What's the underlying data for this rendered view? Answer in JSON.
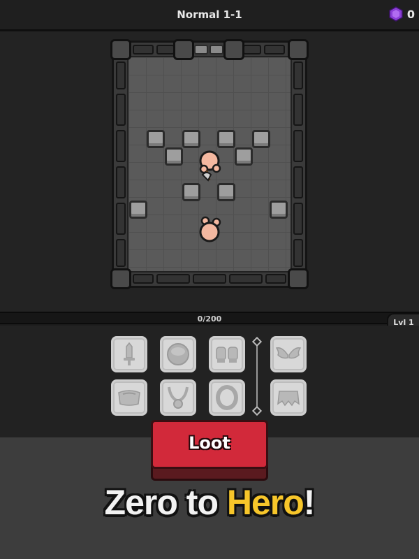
{
  "header": {
    "level_title": "Normal 1-1",
    "gem_count": "0",
    "gem_icon": "purple-gem-icon",
    "gem_color": "#8a3dd6"
  },
  "progress": {
    "xp_text": "0/200",
    "level_badge": "Lvl 1"
  },
  "equipment": {
    "slots": [
      {
        "name": "sword-icon"
      },
      {
        "name": "shield-icon"
      },
      {
        "name": "gloves-icon"
      },
      {
        "name": "wings-icon"
      },
      {
        "name": "armor-icon"
      },
      {
        "name": "amulet-icon"
      },
      {
        "name": "ring-icon"
      },
      {
        "name": "cape-icon"
      }
    ]
  },
  "actions": {
    "loot_label": "Loot",
    "loot_color": "#d2293a"
  },
  "tagline": {
    "part1": "Zero to ",
    "part2": "Hero",
    "part3": "!",
    "highlight_color": "#f7c62a"
  }
}
